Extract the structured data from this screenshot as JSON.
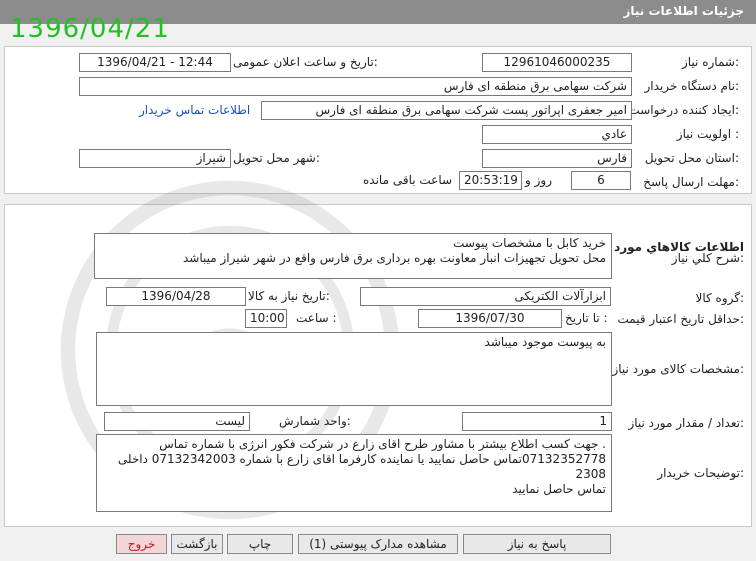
{
  "window_title": "جزئیات اطلاعات نیاز",
  "date_stamp": "1396/04/21",
  "need_info": {
    "need_number_label": "شماره نیاز:",
    "need_number": "1296104600023­5",
    "announce_label": "تاریخ و ساعت اعلان عمومی:",
    "announce_value": "1396/04/21 - 12:44",
    "buyer_org_label": "نام دستگاه خریدار:",
    "buyer_org": "شرکت سهامی برق منطقه ای فارس",
    "creator_label": "ایجاد کننده درخواست:",
    "creator": "امیر جعفری اپراتور پست شرکت سهامی برق منطقه ای فارس",
    "contact_link": "اطلاعات تماس خریدار",
    "priority_label": "اولویت نیاز :",
    "priority": "عادي",
    "province_label": "استان محل تحویل:",
    "province": "فارس",
    "city_label": "شهر محل تحویل:",
    "city": "شیراز",
    "deadline_label": "مهلت ارسال پاسخ:",
    "deadline_days": "6",
    "days_word": "روز و",
    "deadline_time": "20:53:19",
    "remaining_word": "ساعت باقی مانده"
  },
  "goods": {
    "section_title": "اطلاعات کالاهاي مورد نياز",
    "summary_label": "شرح کلي نياز:",
    "summary": "خرید کابل با مشخصات پیوست\nمحل تحویل تجهیزات انبار معاونت بهره برداری برق فارس واقع در شهر شیراز میباشد",
    "group_label": "گروه کالا:",
    "group": "ابزارآلات الکتریکی",
    "need_date_label": "تاریخ نیاز به کالا:",
    "need_date": "1396/04/28",
    "validity_label": "حداقل تاریخ اعتبار قیمت:",
    "to_date_label": "تا تاریخ :",
    "validity_date": "1396/07/30",
    "time_label": "ساعت :",
    "validity_time": "10:00",
    "specs_label": "مشخصات کالای مورد نیاز:",
    "specs": "به پیوست موجود میباشد",
    "quantity_label": "تعداد / مقدار مورد نیاز:",
    "quantity": "1",
    "unit_label": "واحد شمارش:",
    "unit": "لیست",
    "buyer_notes_label": "توضیحات خریدار:",
    "buyer_notes": ". جهت کسب اطلاع بیشتر با مشاور طرح اقای زارع در شرکت فکور انرژی با شماره تماس\n07132352778تماس حاصل نمایید یا نماینده کارفرما اقای زارع با شماره 07132342003 داخلی 2308\nتماس حاصل نمایید"
  },
  "buttons": {
    "reply": "پاسخ به نیاز",
    "view_docs": "مشاهده مدارک پیوستی (1)",
    "print": "چاپ",
    "back": "بازگشت",
    "exit": "خروج"
  }
}
